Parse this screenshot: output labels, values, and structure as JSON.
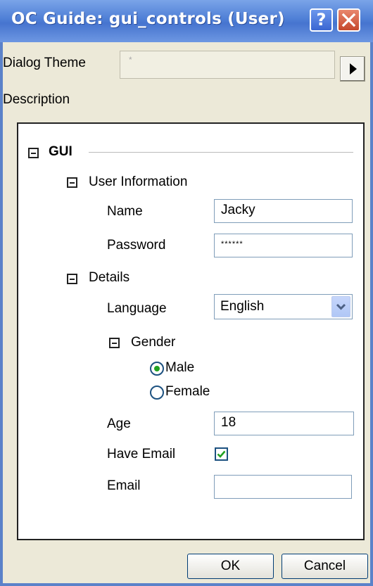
{
  "window": {
    "title": "OC Guide: gui_controls (User)",
    "help_icon": "?",
    "close_icon": "✕"
  },
  "dialog_theme": {
    "label": "Dialog Theme",
    "value": "*"
  },
  "description": {
    "label": "Description"
  },
  "tree": {
    "root_label": "GUI",
    "user_information": {
      "label": "User Information",
      "name_label": "Name",
      "name_value": "Jacky",
      "password_label": "Password",
      "password_value": "******"
    },
    "details": {
      "label": "Details",
      "language_label": "Language",
      "language_value": "English",
      "gender": {
        "label": "Gender",
        "options": [
          "Male",
          "Female"
        ],
        "selected": "Male"
      },
      "age_label": "Age",
      "age_value": "18",
      "have_email_label": "Have Email",
      "have_email_checked": true,
      "email_label": "Email",
      "email_value": ""
    }
  },
  "buttons": {
    "ok": "OK",
    "cancel": "Cancel"
  },
  "colors": {
    "title_bar": "#4f7fd6",
    "window_bg": "#ece9d8",
    "check_mark": "#21a121",
    "close_button": "#c5482b"
  }
}
